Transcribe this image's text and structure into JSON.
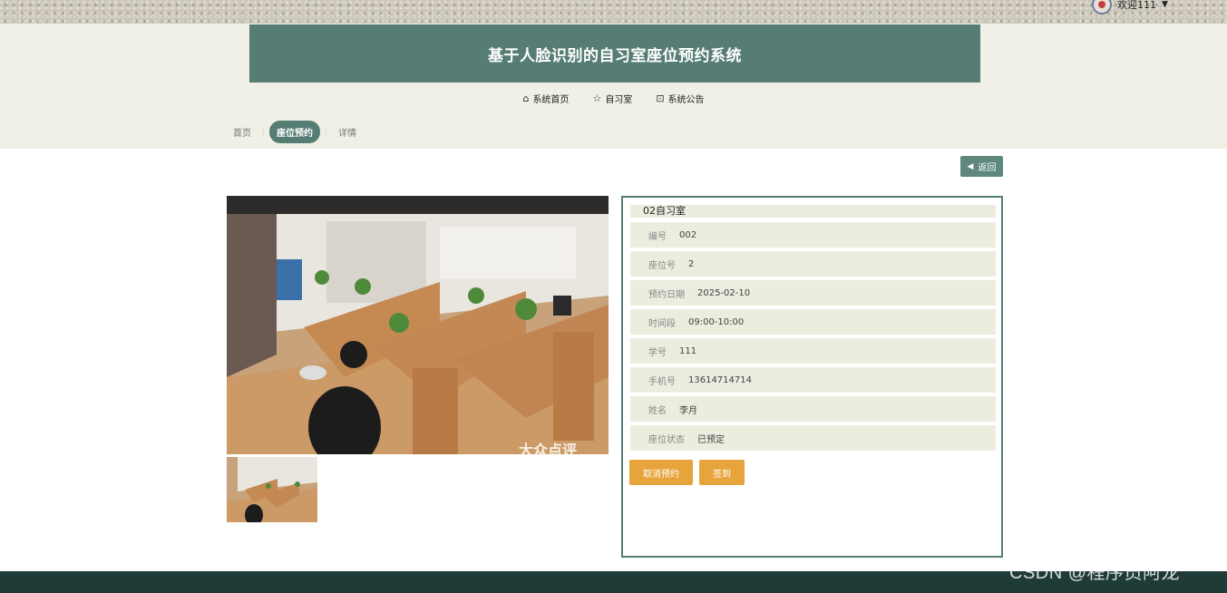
{
  "header": {
    "welcome_text": "欢迎111",
    "title": "基于人脸识别的自习室座位预约系统"
  },
  "nav": {
    "items": [
      {
        "label": "系统首页",
        "icon": "home-icon"
      },
      {
        "label": "自习室",
        "icon": "star-icon"
      },
      {
        "label": "系统公告",
        "icon": "bag-icon"
      }
    ]
  },
  "breadcrumb": {
    "items": [
      "首页",
      "座位预约",
      "详情"
    ],
    "active_index": 1
  },
  "back_button": {
    "label": "返回",
    "icon": "caret-left-icon"
  },
  "detail": {
    "title": "02自习室",
    "fields": [
      {
        "label": "编号",
        "value": "002"
      },
      {
        "label": "座位号",
        "value": "2"
      },
      {
        "label": "预约日期",
        "value": "2025-02-10"
      },
      {
        "label": "时间段",
        "value": "09:00-10:00"
      },
      {
        "label": "学号",
        "value": "111"
      },
      {
        "label": "手机号",
        "value": "13614714714"
      },
      {
        "label": "姓名",
        "value": "李月"
      },
      {
        "label": "座位状态",
        "value": "已预定"
      }
    ]
  },
  "actions": {
    "cancel_label": "取消预约",
    "checkin_label": "签到"
  },
  "photo": {
    "watermark": "大众点评"
  },
  "watermark": "CSDN @程序员阿龙",
  "colors": {
    "primary": "#567d74",
    "accent": "#e8a43c",
    "footer": "#1f3b38",
    "band": "#f0f0e6"
  }
}
